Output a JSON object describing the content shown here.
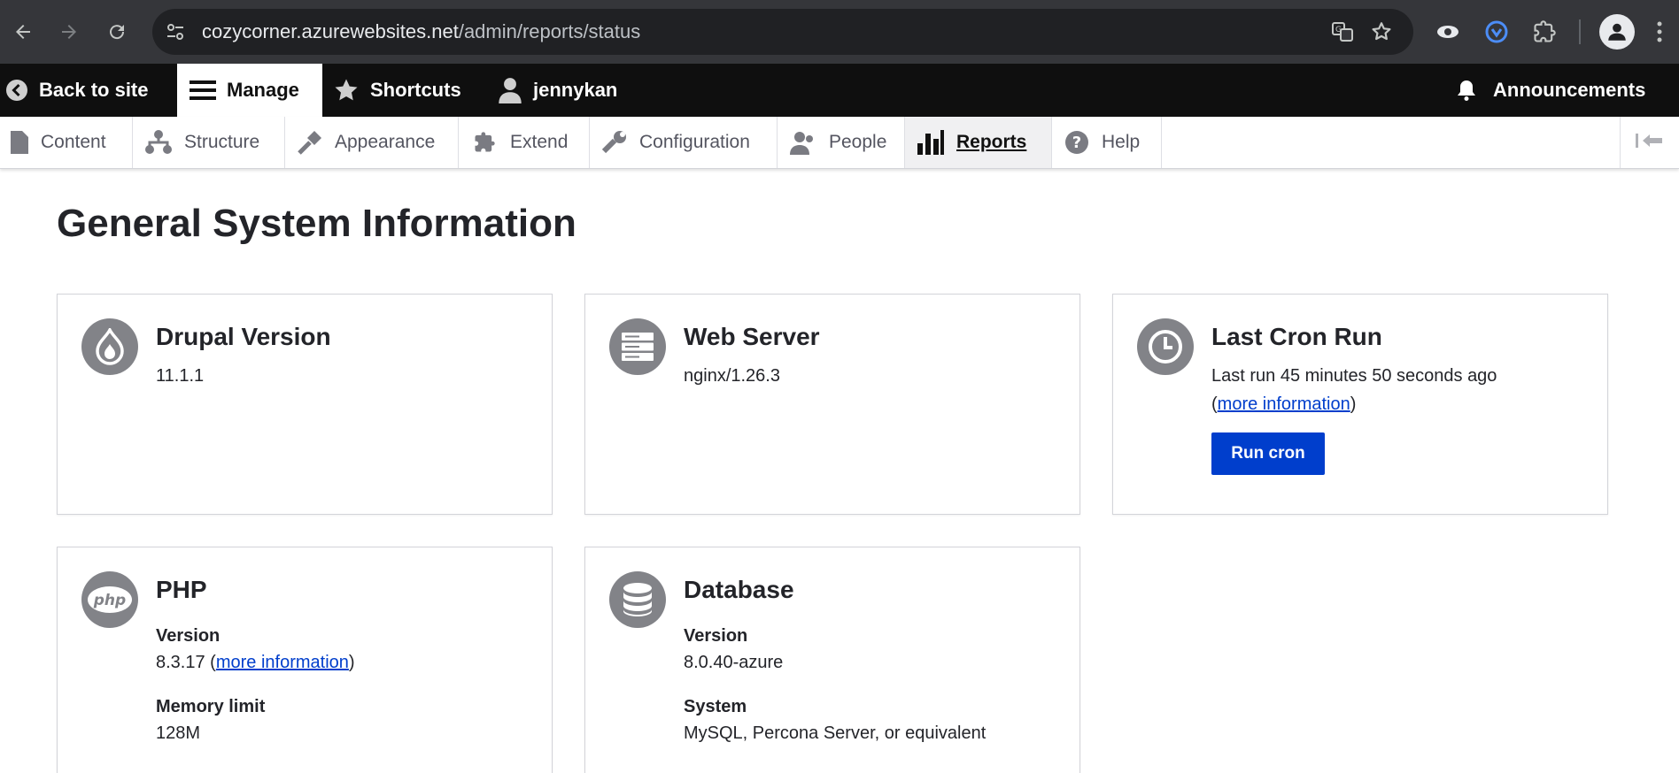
{
  "browser": {
    "url_host": "cozycorner.azurewebsites.net",
    "url_path": "/admin/reports/status"
  },
  "toolbar": {
    "back_label": "Back to site",
    "manage_label": "Manage",
    "shortcuts_label": "Shortcuts",
    "user_label": "jennykan",
    "announcements_label": "Announcements"
  },
  "tray": {
    "items": [
      {
        "label": "Content"
      },
      {
        "label": "Structure"
      },
      {
        "label": "Appearance"
      },
      {
        "label": "Extend"
      },
      {
        "label": "Configuration"
      },
      {
        "label": "People"
      },
      {
        "label": "Reports"
      },
      {
        "label": "Help"
      }
    ]
  },
  "page": {
    "title": "General System Information"
  },
  "cards": {
    "drupal": {
      "title": "Drupal Version",
      "value": "11.1.1"
    },
    "webserver": {
      "title": "Web Server",
      "value": "nginx/1.26.3"
    },
    "cron": {
      "title": "Last Cron Run",
      "text": "Last run 45 minutes 50 seconds ago",
      "open_paren": "(",
      "link": "more information",
      "close_paren": ")",
      "button": "Run cron"
    },
    "php": {
      "title": "PHP",
      "version_label": "Version",
      "version_value": "8.3.17 (",
      "version_link": "more information",
      "version_close": ")",
      "memory_label": "Memory limit",
      "memory_value": "128M",
      "icon_text": "php"
    },
    "database": {
      "title": "Database",
      "version_label": "Version",
      "version_value": "8.0.40-azure",
      "system_label": "System",
      "system_value": "MySQL, Percona Server, or equivalent"
    }
  }
}
